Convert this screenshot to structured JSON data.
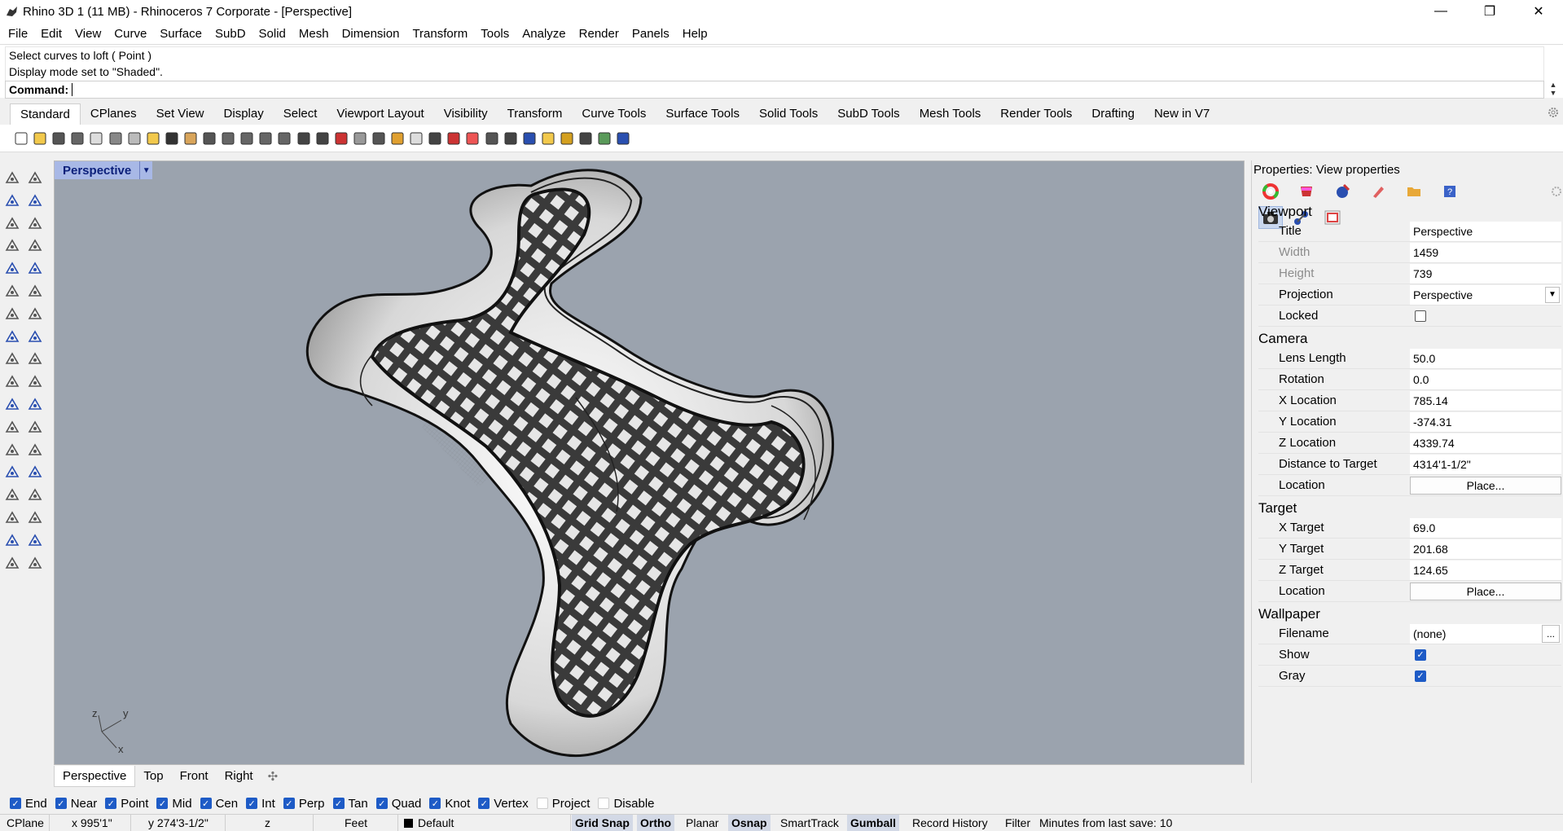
{
  "window": {
    "title": "Rhino 3D 1 (11 MB) - Rhinoceros 7 Corporate - [Perspective]",
    "minimize": "—",
    "restore": "❐",
    "close": "✕"
  },
  "menu": [
    "File",
    "Edit",
    "View",
    "Curve",
    "Surface",
    "SubD",
    "Solid",
    "Mesh",
    "Dimension",
    "Transform",
    "Tools",
    "Analyze",
    "Render",
    "Panels",
    "Help"
  ],
  "command": {
    "history": [
      "Select curves to loft ( Point )",
      "Display mode set to \"Shaded\"."
    ],
    "prompt": "Command:"
  },
  "toolbar_tabs": [
    "Standard",
    "CPlanes",
    "Set View",
    "Display",
    "Select",
    "Viewport Layout",
    "Visibility",
    "Transform",
    "Curve Tools",
    "Surface Tools",
    "Solid Tools",
    "SubD Tools",
    "Mesh Tools",
    "Render Tools",
    "Drafting",
    "New in V7"
  ],
  "standard_tools": [
    "new-icon",
    "open-icon",
    "save-icon",
    "print-icon",
    "import-icon",
    "cut-icon",
    "copy-icon",
    "paste-icon",
    "undo-icon",
    "pan-icon",
    "move-view-icon",
    "zoom-icon",
    "zoom-window-icon",
    "zoom-extents-icon",
    "zoom-selected-icon",
    "rotate-view-icon",
    "viewport-layout-icon",
    "car-icon",
    "blocks-icon",
    "grid-icon",
    "select-icon",
    "bulb-icon",
    "lock-icon",
    "layer-icon",
    "color-wheel-icon",
    "shade-icon",
    "rendered-icon",
    "material-icon",
    "highlight-icon",
    "options-icon",
    "snap-icon",
    "render-icon",
    "help-icon"
  ],
  "viewport": {
    "name": "Perspective",
    "axis_y": "y",
    "axis_z": "z",
    "axis_x": "x"
  },
  "viewport_tabs": [
    "Perspective",
    "Top",
    "Front",
    "Right"
  ],
  "properties": {
    "header": "Properties: View properties",
    "sections": {
      "viewport": "Viewport",
      "camera": "Camera",
      "target": "Target",
      "wallpaper": "Wallpaper"
    },
    "viewport": {
      "title_label": "Title",
      "title_value": "Perspective",
      "width_label": "Width",
      "width_value": "1459",
      "height_label": "Height",
      "height_value": "739",
      "projection_label": "Projection",
      "projection_value": "Perspective",
      "locked_label": "Locked",
      "locked": false
    },
    "camera": {
      "lens_label": "Lens Length",
      "lens_value": "50.0",
      "rotation_label": "Rotation",
      "rotation_value": "0.0",
      "xloc_label": "X Location",
      "xloc_value": "785.14",
      "yloc_label": "Y Location",
      "yloc_value": "-374.31",
      "zloc_label": "Z Location",
      "zloc_value": "4339.74",
      "dist_label": "Distance to Target",
      "dist_value": "4314'1-1/2\"",
      "location_label": "Location",
      "location_button": "Place..."
    },
    "target": {
      "x_label": "X Target",
      "x_value": "69.0",
      "y_label": "Y Target",
      "y_value": "201.68",
      "z_label": "Z Target",
      "z_value": "124.65",
      "location_label": "Location",
      "location_button": "Place..."
    },
    "wallpaper": {
      "filename_label": "Filename",
      "filename_value": "(none)",
      "browse": "...",
      "show_label": "Show",
      "show": true,
      "gray_label": "Gray",
      "gray": true
    }
  },
  "osnaps": [
    {
      "label": "End",
      "checked": true
    },
    {
      "label": "Near",
      "checked": true
    },
    {
      "label": "Point",
      "checked": true
    },
    {
      "label": "Mid",
      "checked": true
    },
    {
      "label": "Cen",
      "checked": true
    },
    {
      "label": "Int",
      "checked": true
    },
    {
      "label": "Perp",
      "checked": true
    },
    {
      "label": "Tan",
      "checked": true
    },
    {
      "label": "Quad",
      "checked": true
    },
    {
      "label": "Knot",
      "checked": true
    },
    {
      "label": "Vertex",
      "checked": true
    },
    {
      "label": "Project",
      "checked": false
    },
    {
      "label": "Disable",
      "checked": false
    }
  ],
  "status": {
    "cplane": "CPlane",
    "x": "x 995'1\"",
    "y": "y 274'3-1/2\"",
    "z": "z",
    "units": "Feet",
    "layer": "Default",
    "grid_snap": "Grid Snap",
    "ortho": "Ortho",
    "planar": "Planar",
    "osnap": "Osnap",
    "smarttrack": "SmartTrack",
    "gumball": "Gumball",
    "record_history": "Record History",
    "filter": "Filter",
    "last_save": "Minutes from last save: 10"
  },
  "colors": {
    "viewport_bg": "#9ba3ae",
    "viewport_title_bg": "#a8b8e6",
    "checkbox_on": "#1e5bc6"
  }
}
